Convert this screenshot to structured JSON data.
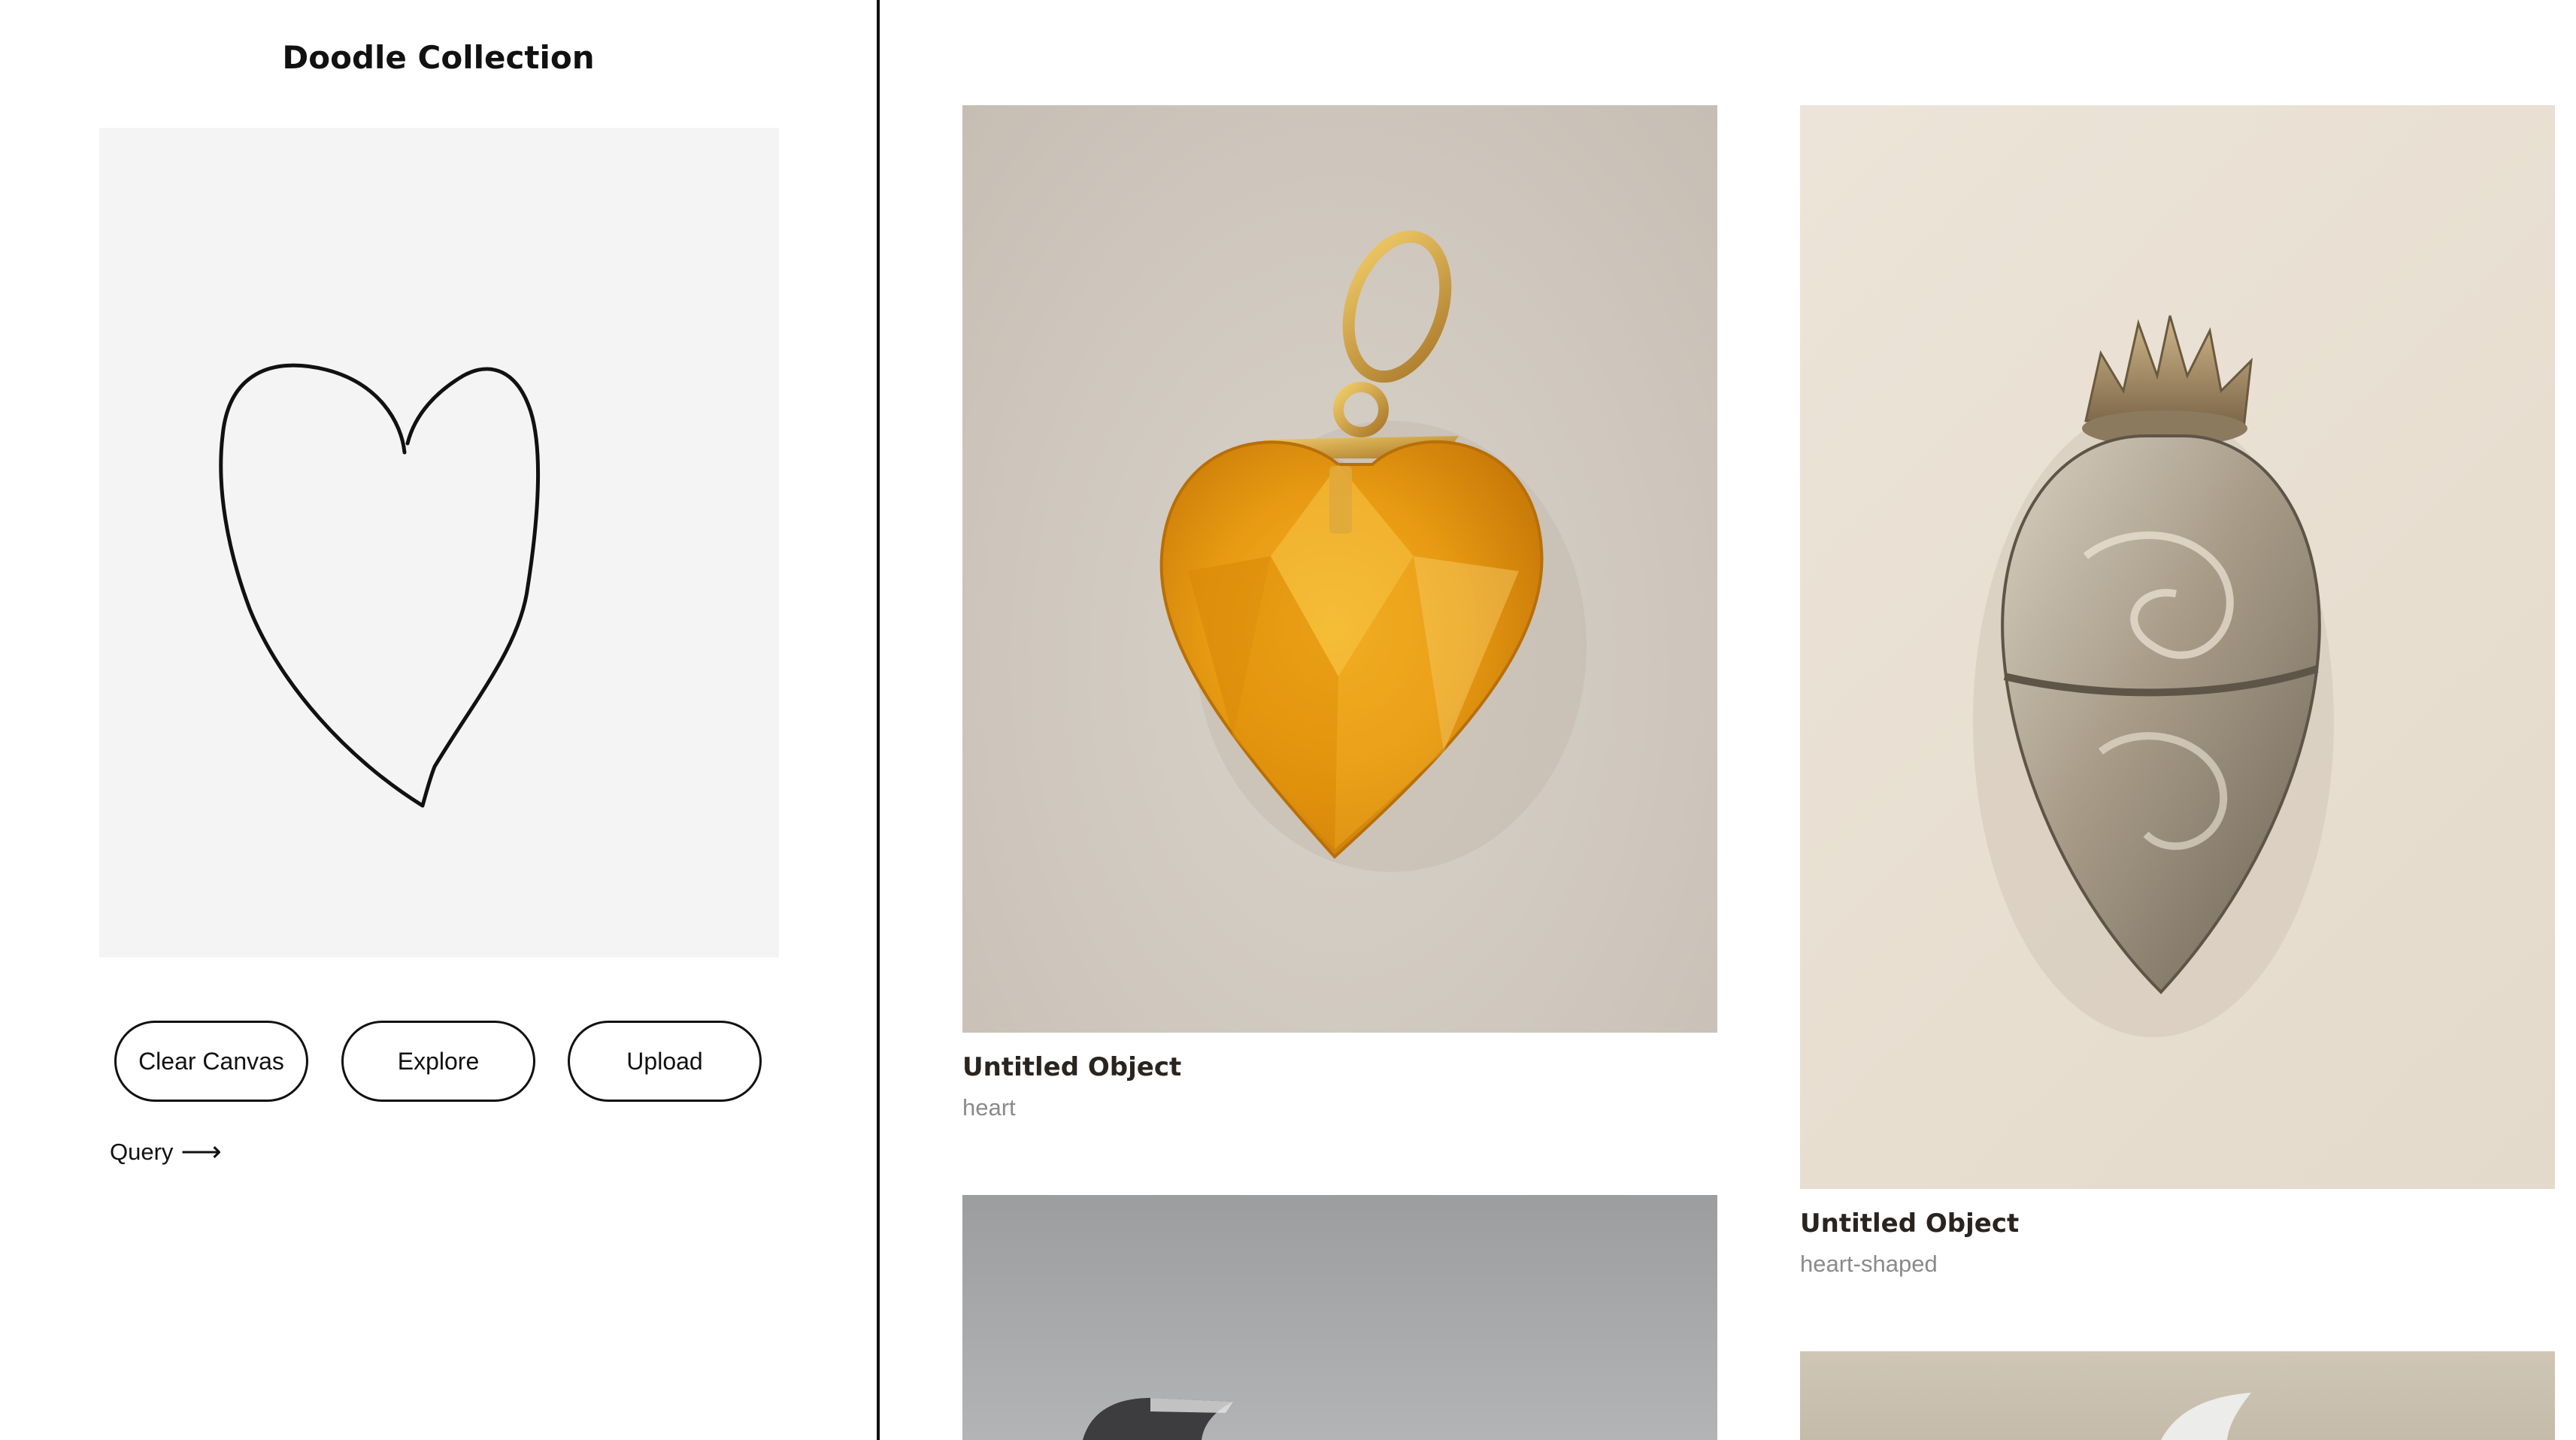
{
  "sidebar": {
    "title": "Doodle Collection",
    "buttons": {
      "clear": "Clear Canvas",
      "explore": "Explore",
      "upload": "Upload"
    },
    "query_label": "Query",
    "query_arrow": "⟶"
  },
  "results": [
    {
      "title": "Untitled Object",
      "subtitle": "heart",
      "image": "amber-heart-pendant"
    },
    {
      "title": "Untitled Object",
      "subtitle": "heart-shaped",
      "image": "silver-sacred-heart-locket"
    },
    {
      "title": "",
      "subtitle": "",
      "image": "metal-object-grey-background"
    },
    {
      "title": "",
      "subtitle": "",
      "image": "silver-object-beige-background"
    }
  ],
  "colors": {
    "canvas_bg": "#f4f4f4",
    "divider": "#111111",
    "subtitle": "#8a8a8a"
  }
}
